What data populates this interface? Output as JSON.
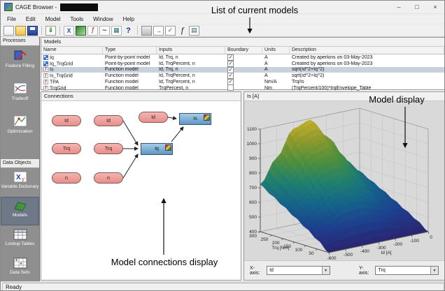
{
  "window": {
    "title": "CAGE Browser -",
    "minimize": "–",
    "maximize": "□",
    "close": "×"
  },
  "menu": [
    "File",
    "Edit",
    "Model",
    "Tools",
    "Window",
    "Help"
  ],
  "toolbar": {
    "icons": [
      "new-project",
      "open-project",
      "save-project",
      "|",
      "import-data",
      "|",
      "new-variable",
      "new-model",
      "new-feature",
      "new-tradeoff",
      "new-dataset",
      "help",
      "|",
      "print",
      "export-model",
      "evaluate-model",
      "fit-model",
      "view-details"
    ]
  },
  "sidebar": {
    "processes_label": "Processes",
    "processes": [
      {
        "label": "Feature Filling"
      },
      {
        "label": "Tradeoff"
      },
      {
        "label": "Optimization"
      }
    ],
    "data_objects_label": "Data Objects",
    "data_objects": [
      {
        "label": "Variable Dictionary",
        "selected": false
      },
      {
        "label": "Models",
        "selected": true
      },
      {
        "label": "Lookup Tables",
        "selected": false
      },
      {
        "label": "Data Sets",
        "selected": false
      }
    ]
  },
  "models": {
    "title": "Models",
    "columns": [
      "Name",
      "Type",
      "Inputs",
      "Boundary",
      "Units",
      "Description"
    ],
    "rows": [
      {
        "name": "Iq",
        "type": "Point-by-point model",
        "inputs": "Id, Trq, n",
        "boundary": true,
        "units": "A",
        "description": "Created by aperkins on 03-May-2023",
        "selected": false
      },
      {
        "name": "Iq_TrqGrid",
        "type": "Point-by-point model",
        "inputs": "Id, TrqPercent, n",
        "boundary": true,
        "units": "A",
        "description": "Created by aperkins on 03-May-2023",
        "selected": false
      },
      {
        "name": "Is",
        "type": "Function model",
        "inputs": "Id, Trq, n",
        "boundary": true,
        "units": "A",
        "description": "sqrt(Id^2+Iq^2)",
        "selected": true
      },
      {
        "name": "Is_TrqGrid",
        "type": "Function model",
        "inputs": "Id, TrqPercent, n",
        "boundary": true,
        "units": "A",
        "description": "sqrt(Id^2+Iq^2)",
        "selected": false
      },
      {
        "name": "TPA",
        "type": "Function model",
        "inputs": "Id, TrqPercent, n",
        "boundary": true,
        "units": "Nm/A",
        "description": "Trq/Is",
        "selected": false
      },
      {
        "name": "TrqGrid",
        "type": "Function model",
        "inputs": "TrqPercent, n",
        "boundary": false,
        "units": "Nm",
        "description": "(TrqPercent/100)*trqEnvelope_Table",
        "selected": false
      }
    ]
  },
  "connections": {
    "title": "Connections",
    "variable_nodes": [
      "Id",
      "Id",
      "Id",
      "Trq",
      "Trq",
      "n",
      "n"
    ],
    "model_nodes": [
      "Is",
      "Iq"
    ]
  },
  "plot": {
    "x_axis_label": "X-axis:",
    "x_axis_value": "Id",
    "y_axis_label": "Y-axis:",
    "y_axis_value": "Trq"
  },
  "chart_data": {
    "type": "surface",
    "title": "Is [A]",
    "x": {
      "label": "Trq [Nm]",
      "min": 0,
      "max": 300,
      "ticks": [
        50,
        100,
        150,
        200,
        250,
        300
      ]
    },
    "y": {
      "label": "Id [A]",
      "min": -600,
      "max": 0,
      "ticks": [
        -600,
        -500,
        -400,
        -300,
        -200,
        -100,
        0
      ]
    },
    "z": {
      "label": "Is [A]",
      "min": 400,
      "max": 1100,
      "ticks": [
        400,
        500,
        600,
        700,
        800,
        900,
        1000,
        1100
      ]
    },
    "values": [
      [
        400,
        400,
        400,
        400,
        400,
        400,
        400
      ],
      [
        464,
        496,
        530,
        537,
        510,
        475,
        454
      ],
      [
        520,
        579,
        643,
        657,
        606,
        540,
        500
      ],
      [
        573,
        658,
        750,
        770,
        698,
        603,
        545
      ],
      [
        624,
        734,
        854,
        880,
        786,
        662,
        588
      ],
      [
        673,
        808,
        955,
        986,
        872,
        721,
        629
      ],
      [
        722,
        881,
        1054,
        1091,
        956,
        778,
        670
      ]
    ],
    "colormap": [
      "#2a2470",
      "#1d3f8e",
      "#14638a",
      "#1f806e",
      "#4e8f3c",
      "#8f992c",
      "#c9b22a"
    ]
  },
  "annotations": {
    "top": "List of current models",
    "right": "Model display",
    "bottom": "Model connections display"
  },
  "status": {
    "text": "Ready"
  }
}
